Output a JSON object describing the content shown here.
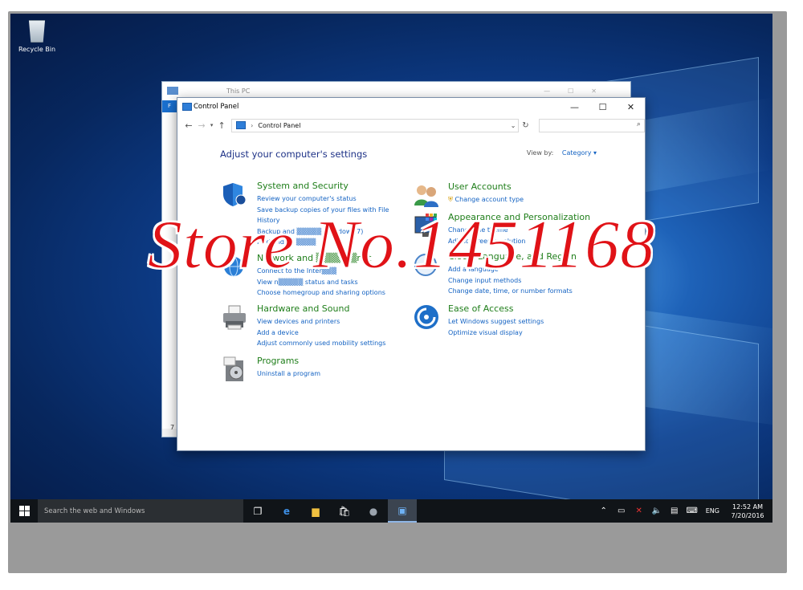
{
  "desktop": {
    "recycle_bin_label": "Recycle Bin"
  },
  "back_window": {
    "title": "This PC",
    "side_char": "7",
    "side_char2": "F"
  },
  "window": {
    "title": "Control Panel",
    "controls": {
      "minimize": "—",
      "maximize": "☐",
      "close": "✕"
    },
    "address": "Control Panel",
    "search_placeholder": ""
  },
  "content": {
    "heading": "Adjust your computer's settings",
    "view_by_label": "View by:",
    "view_by_value": "Category ▾",
    "left": [
      {
        "title": "System and Security",
        "links": [
          "Review your computer's status",
          "Save backup copies of your files with File",
          "History",
          "Backup and ▒▒▒▒▒ (Windows 7)",
          "Find and fix ▒▒▒▒"
        ]
      },
      {
        "title": "Network and ▒▒▒▒▒▒net",
        "links": [
          "Connect to the Inter▒▒▒",
          "View n▒▒▒▒▒ status and tasks",
          "Choose homegroup and sharing options"
        ]
      },
      {
        "title": "Hardware and Sound",
        "links": [
          "View devices and printers",
          "Add a device",
          "Adjust commonly used mobility settings"
        ]
      },
      {
        "title": "Programs",
        "links": [
          "Uninstall a program"
        ]
      }
    ],
    "right": [
      {
        "title": "User Accounts",
        "links": [
          "Change account type"
        ]
      },
      {
        "title": "Appearance and Personalization",
        "links": [
          "Change the theme",
          "Adjust screen resolution"
        ]
      },
      {
        "title": "Clock, Language, and Region",
        "links": [
          "Add a language",
          "Change input methods",
          "Change date, time, or number formats"
        ]
      },
      {
        "title": "Ease of Access",
        "links": [
          "Let Windows suggest settings",
          "Optimize visual display"
        ]
      }
    ]
  },
  "taskbar": {
    "search_placeholder": "Search the web and Windows",
    "language": "ENG",
    "time": "12:52 AM",
    "date": "7/20/2016"
  },
  "watermark": "Store No.1451168",
  "colors": {
    "link": "#1463c3",
    "category_title": "#1f7e1a",
    "heading": "#1e3287",
    "watermark": "#e01217"
  }
}
